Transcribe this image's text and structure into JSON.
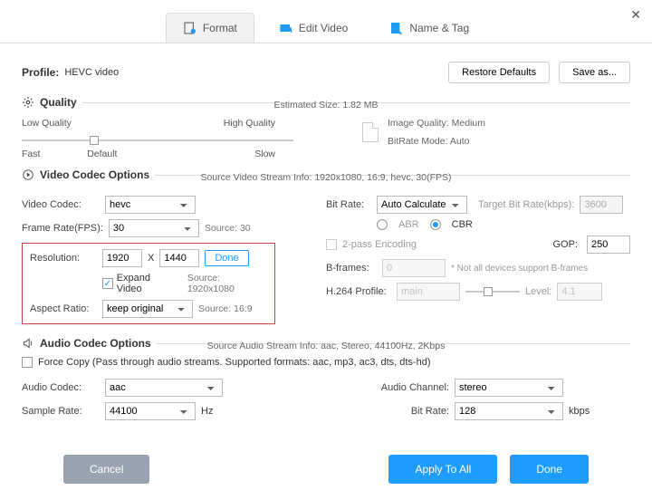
{
  "window": {
    "close_icon": "✕"
  },
  "tabs": {
    "format": "Format",
    "edit_video": "Edit Video",
    "name_tag": "Name & Tag",
    "active": "format"
  },
  "profile": {
    "label": "Profile:",
    "value": "HEVC video",
    "restore_defaults": "Restore Defaults",
    "save_as": "Save as..."
  },
  "quality": {
    "heading": "Quality",
    "estimated_label": "Estimated Size:",
    "estimated_value": "1.82 MB",
    "low": "Low Quality",
    "high": "High Quality",
    "fast": "Fast",
    "default": "Default",
    "slow": "Slow",
    "image_quality_label": "Image Quality:",
    "image_quality_value": "Medium",
    "bitrate_mode_label": "BitRate Mode:",
    "bitrate_mode_value": "Auto"
  },
  "video": {
    "heading": "Video Codec Options",
    "source_info": "Source Video Stream Info: 1920x1080, 16:9, hevc, 30(FPS)",
    "codec_label": "Video Codec:",
    "codec_value": "hevc",
    "fps_label": "Frame Rate(FPS):",
    "fps_value": "30",
    "fps_source": "Source: 30",
    "res_label": "Resolution:",
    "res_w": "1920",
    "res_x": "X",
    "res_h": "1440",
    "res_done": "Done",
    "expand_video": "Expand Video",
    "res_source": "Source: 1920x1080",
    "aspect_label": "Aspect Ratio:",
    "aspect_value": "keep original",
    "aspect_source": "Source: 16:9",
    "bitrate_label": "Bit Rate:",
    "bitrate_value": "Auto Calculate",
    "target_label": "Target Bit Rate(kbps):",
    "target_value": "3600",
    "abr": "ABR",
    "cbr": "CBR",
    "twopass": "2-pass Encoding",
    "gop_label": "GOP:",
    "gop_value": "250",
    "bframes_label": "B-frames:",
    "bframes_value": "0",
    "bframes_note": "* Not all devices support B-frames",
    "h264_label": "H.264 Profile:",
    "h264_value": "main",
    "level_label": "Level:",
    "level_value": "4.1"
  },
  "audio": {
    "heading": "Audio Codec Options",
    "source_info": "Source Audio Stream Info: aac, Stereo, 44100Hz, 2Kbps",
    "force_copy": "Force Copy (Pass through audio streams. Supported formats: aac, mp3, ac3, dts, dts-hd)",
    "codec_label": "Audio Codec:",
    "codec_value": "aac",
    "sample_label": "Sample Rate:",
    "sample_value": "44100",
    "hz": "Hz",
    "channel_label": "Audio Channel:",
    "channel_value": "stereo",
    "bitrate_label": "Bit Rate:",
    "bitrate_value": "128",
    "kbps": "kbps"
  },
  "footer": {
    "cancel": "Cancel",
    "apply_all": "Apply To All",
    "done": "Done"
  }
}
